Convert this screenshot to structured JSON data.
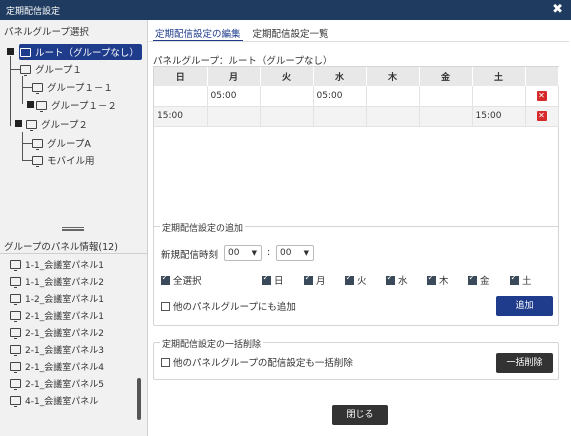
{
  "dialog": {
    "title": "定期配信設定",
    "close": "✖"
  },
  "left": {
    "header": "パネルグループ選択",
    "tree": [
      {
        "label": "ルート（グループなし）"
      },
      {
        "label": "グループ１"
      },
      {
        "label": "グループ１－１"
      },
      {
        "label": "グループ１－２"
      },
      {
        "label": "グループ２"
      },
      {
        "label": "グループA"
      },
      {
        "label": "モバイル用"
      }
    ],
    "panel_header": "グループのパネル情報(12)",
    "panels": [
      "1-1_会議室パネル1",
      "1-1_会議室パネル2",
      "1-2_会議室パネル1",
      "2-1_会議室パネル1",
      "2-1_会議室パネル2",
      "2-1_会議室パネル3",
      "2-1_会議室パネル4",
      "2-1_会議室パネル5",
      "4-1_会議室パネル"
    ]
  },
  "tabs": [
    {
      "label": "定期配信設定の編集"
    },
    {
      "label": "定期配信設定一覧"
    }
  ],
  "panel_group_label": "パネルグループ：ルート（グループなし）",
  "schedule": {
    "days": [
      "日",
      "月",
      "火",
      "水",
      "木",
      "金",
      "土"
    ],
    "rows": [
      [
        "",
        "05:00",
        "",
        "05:00",
        "",
        "",
        ""
      ],
      [
        "15:00",
        "",
        "",
        "",
        "",
        "",
        "15:00"
      ]
    ],
    "delete_icon": "✕"
  },
  "add_section": {
    "legend": "定期配信設定の追加",
    "time_label": "新規配信時刻",
    "hour": "00",
    "minute": "00",
    "colon": ":",
    "select_all": "全選択",
    "day_checks": [
      "日",
      "月",
      "火",
      "水",
      "木",
      "金",
      "土"
    ],
    "other_groups": "他のパネルグループにも追加",
    "add_button": "追加"
  },
  "bulk_section": {
    "legend": "定期配信設定の一括削除",
    "other_groups": "他のパネルグループの配信設定も一括削除",
    "delete_button": "一括削除"
  },
  "close_button": "閉じる",
  "colors": {
    "titlebar": "#1f3c60",
    "accent": "#1f3c8c",
    "delete": "#d52b2b"
  }
}
